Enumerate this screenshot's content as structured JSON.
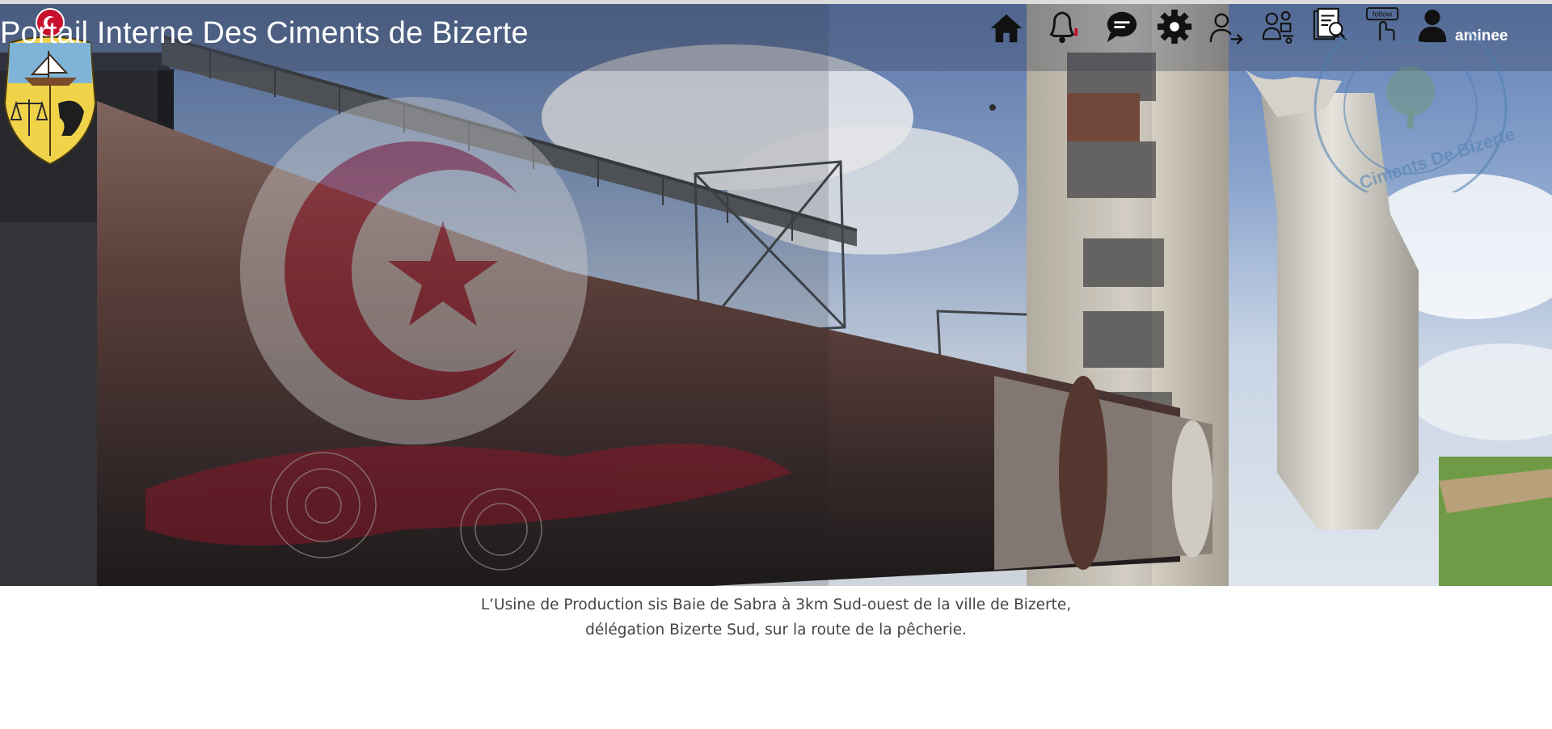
{
  "header": {
    "title": "Portail Interne Des Ciments de Bizerte",
    "username": "aminee"
  },
  "nav": {
    "items": [
      {
        "name": "home-icon"
      },
      {
        "name": "notifications-bell-icon"
      },
      {
        "name": "chat-bubble-icon"
      },
      {
        "name": "settings-gear-icon"
      },
      {
        "name": "logout-user-arrow-icon"
      },
      {
        "name": "staff-team-icon"
      },
      {
        "name": "document-search-icon"
      },
      {
        "name": "follow-icon",
        "badge_text": "follow"
      },
      {
        "name": "user-profile-icon"
      }
    ]
  },
  "watermark": {
    "text": "Ciments De Bizerte"
  },
  "caption": {
    "line1": "L’Usine de Production sis Baie de Sabra à 3km Sud-ouest de la ville de Bizerte,",
    "line2": "délégation Bizerte Sud, sur la route de la pêcherie."
  },
  "colors": {
    "flag_red": "#c8102e",
    "title_text": "#ffffff",
    "caption_text": "#444444"
  }
}
